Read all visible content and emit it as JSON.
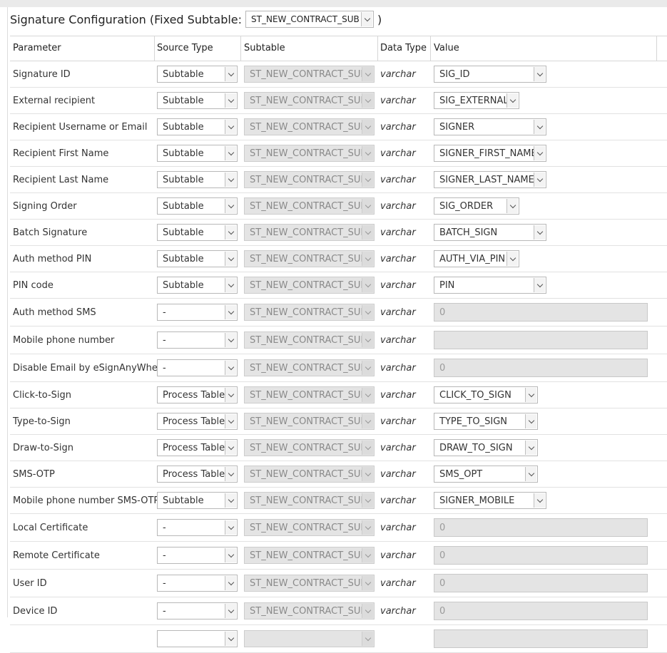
{
  "title": {
    "text": "Signature Configuration (Fixed Subtable:",
    "subtable_value": "ST_NEW_CONTRACT_SUB",
    "close": ")"
  },
  "columns": {
    "parameter": "Parameter",
    "source_type": "Source Type",
    "subtable": "Subtable",
    "data_type": "Data Type",
    "value": "Value"
  },
  "rows": [
    {
      "param": "Signature ID",
      "source": "Subtable",
      "subtable": "ST_NEW_CONTRACT_SUB",
      "dtype": "varchar",
      "value": "SIG_ID",
      "kind": "select",
      "w": 158
    },
    {
      "param": "External recipient",
      "source": "Subtable",
      "subtable": "ST_NEW_CONTRACT_SUB",
      "dtype": "varchar",
      "value": "SIG_EXTERNAL",
      "kind": "select",
      "w": 120
    },
    {
      "param": "Recipient Username or Email",
      "source": "Subtable",
      "subtable": "ST_NEW_CONTRACT_SUB",
      "dtype": "varchar",
      "value": "SIGNER",
      "kind": "select",
      "w": 158
    },
    {
      "param": "Recipient First Name",
      "source": "Subtable",
      "subtable": "ST_NEW_CONTRACT_SUB",
      "dtype": "varchar",
      "value": "SIGNER_FIRST_NAME",
      "kind": "select",
      "w": 158
    },
    {
      "param": "Recipient Last Name",
      "source": "Subtable",
      "subtable": "ST_NEW_CONTRACT_SUB",
      "dtype": "varchar",
      "value": "SIGNER_LAST_NAME",
      "kind": "select",
      "w": 158
    },
    {
      "param": "Signing Order",
      "source": "Subtable",
      "subtable": "ST_NEW_CONTRACT_SUB",
      "dtype": "varchar",
      "value": "SIG_ORDER",
      "kind": "select",
      "w": 120
    },
    {
      "param": "Batch Signature",
      "source": "Subtable",
      "subtable": "ST_NEW_CONTRACT_SUB",
      "dtype": "varchar",
      "value": "BATCH_SIGN",
      "kind": "select",
      "w": 158
    },
    {
      "param": "Auth method PIN",
      "source": "Subtable",
      "subtable": "ST_NEW_CONTRACT_SUB",
      "dtype": "varchar",
      "value": "AUTH_VIA_PIN",
      "kind": "select",
      "w": 120
    },
    {
      "param": "PIN code",
      "source": "Subtable",
      "subtable": "ST_NEW_CONTRACT_SUB",
      "dtype": "varchar",
      "value": "PIN",
      "kind": "select",
      "w": 158
    },
    {
      "param": "Auth method SMS",
      "source": "-",
      "subtable": "ST_NEW_CONTRACT_SUB",
      "dtype": "varchar",
      "value": "0",
      "kind": "input"
    },
    {
      "param": "Mobile phone number",
      "source": "-",
      "subtable": "ST_NEW_CONTRACT_SUB",
      "dtype": "varchar",
      "value": "",
      "kind": "input"
    },
    {
      "param": "Disable Email by eSignAnyWhere",
      "source": "-",
      "subtable": "ST_NEW_CONTRACT_SUB",
      "dtype": "varchar",
      "value": "0",
      "kind": "input"
    },
    {
      "param": "Click-to-Sign",
      "source": "Process Table",
      "subtable": "ST_NEW_CONTRACT_SUB",
      "dtype": "varchar",
      "value": "CLICK_TO_SIGN",
      "kind": "select",
      "w": 146
    },
    {
      "param": "Type-to-Sign",
      "source": "Process Table",
      "subtable": "ST_NEW_CONTRACT_SUB",
      "dtype": "varchar",
      "value": "TYPE_TO_SIGN",
      "kind": "select",
      "w": 146
    },
    {
      "param": "Draw-to-Sign",
      "source": "Process Table",
      "subtable": "ST_NEW_CONTRACT_SUB",
      "dtype": "varchar",
      "value": "DRAW_TO_SIGN",
      "kind": "select",
      "w": 146
    },
    {
      "param": "SMS-OTP",
      "source": "Process Table",
      "subtable": "ST_NEW_CONTRACT_SUB",
      "dtype": "varchar",
      "value": "SMS_OPT",
      "kind": "select",
      "w": 146
    },
    {
      "param": "Mobile phone number SMS-OTP",
      "source": "Subtable",
      "subtable": "ST_NEW_CONTRACT_SUB",
      "dtype": "varchar",
      "value": "SIGNER_MOBILE",
      "kind": "select",
      "w": 158
    },
    {
      "param": "Local Certificate",
      "source": "-",
      "subtable": "ST_NEW_CONTRACT_SUB",
      "dtype": "varchar",
      "value": "0",
      "kind": "input"
    },
    {
      "param": "Remote Certificate",
      "source": "-",
      "subtable": "ST_NEW_CONTRACT_SUB",
      "dtype": "varchar",
      "value": "0",
      "kind": "input"
    },
    {
      "param": "User ID",
      "source": "-",
      "subtable": "ST_NEW_CONTRACT_SUB",
      "dtype": "varchar",
      "value": "0",
      "kind": "input"
    },
    {
      "param": "Device ID",
      "source": "-",
      "subtable": "ST_NEW_CONTRACT_SUB",
      "dtype": "varchar",
      "value": "0",
      "kind": "input"
    },
    {
      "param": "",
      "source": "",
      "subtable": "",
      "dtype": "",
      "value": "",
      "kind": "input"
    }
  ]
}
